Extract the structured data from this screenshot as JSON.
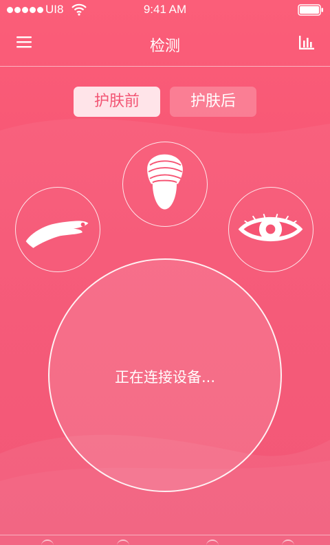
{
  "status_bar": {
    "carrier": "UI8",
    "time": "9:41 AM"
  },
  "nav": {
    "title": "检测"
  },
  "tabs": [
    {
      "label": "护肤前",
      "active": true
    },
    {
      "label": "护肤后",
      "active": false
    }
  ],
  "modes": [
    {
      "icon": "hand-icon"
    },
    {
      "icon": "face-icon"
    },
    {
      "icon": "eye-icon"
    }
  ],
  "connection": {
    "status": "正在连接设备..."
  },
  "colors": {
    "background": "#f65473",
    "accent": "#f25473",
    "active_tab_bg": "#ffe4e9"
  }
}
